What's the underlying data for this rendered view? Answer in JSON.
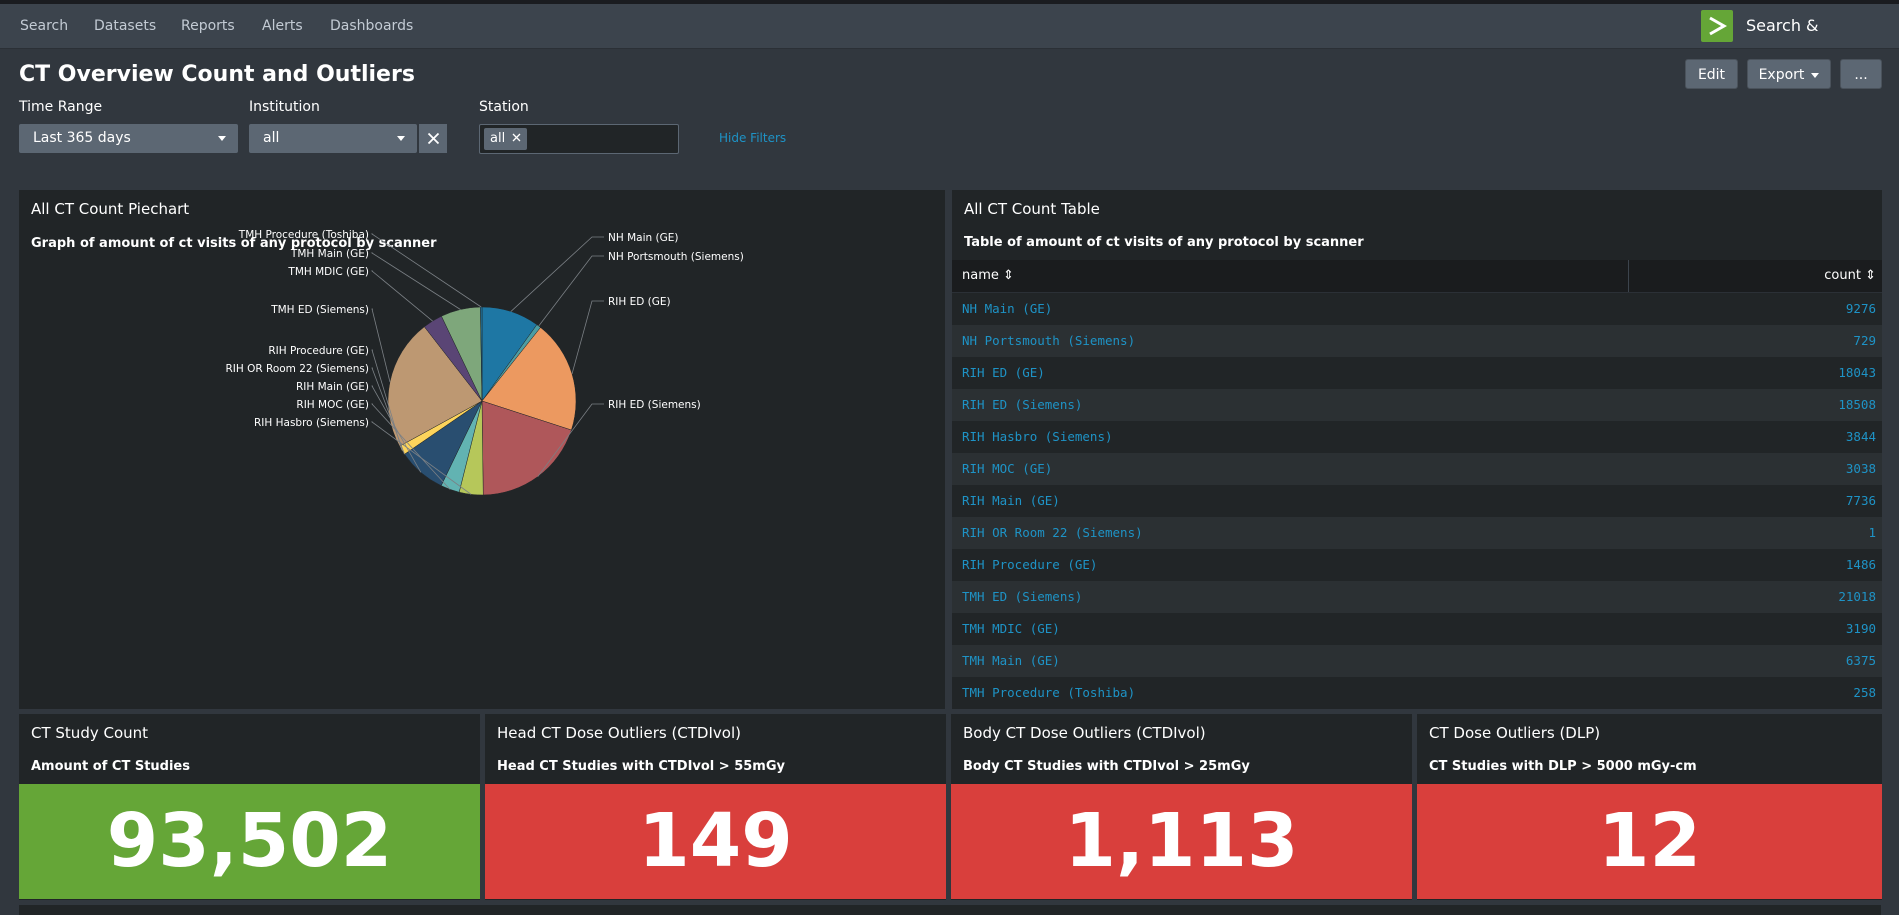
{
  "nav": {
    "items": [
      "Search",
      "Datasets",
      "Reports",
      "Alerts",
      "Dashboards"
    ],
    "app_name": "Search & Reporting",
    "logo_color": "#65a637"
  },
  "dashboard": {
    "title": "CT Overview Count and Outliers",
    "buttons": {
      "edit": "Edit",
      "export": "Export",
      "more": "..."
    }
  },
  "filters": {
    "time_range": {
      "label": "Time Range",
      "value": "Last 365 days"
    },
    "institution": {
      "label": "Institution",
      "value": "all"
    },
    "station": {
      "label": "Station",
      "chips": [
        "all"
      ]
    },
    "hide_label": "Hide Filters"
  },
  "pie_panel": {
    "title": "All CT Count Piechart",
    "subtitle": "Graph of amount of ct visits of any protocol by scanner"
  },
  "chart_data": {
    "type": "pie",
    "title": "Graph of amount of ct visits of any protocol by scanner",
    "slices": [
      {
        "label": "NH Main (GE)",
        "value": 9276,
        "color": "#1e77a4"
      },
      {
        "label": "NH Portsmouth (Siemens)",
        "value": 729,
        "color": "#4d9da3"
      },
      {
        "label": "RIH ED (GE)",
        "value": 18043,
        "color": "#ec9960"
      },
      {
        "label": "RIH ED (Siemens)",
        "value": 18508,
        "color": "#af575a"
      },
      {
        "label": "RIH Hasbro (Siemens)",
        "value": 3844,
        "color": "#b6c75a"
      },
      {
        "label": "RIH MOC (GE)",
        "value": 3038,
        "color": "#62b3b2"
      },
      {
        "label": "RIH Main (GE)",
        "value": 7736,
        "color": "#294e70"
      },
      {
        "label": "RIH OR Room 22 (Siemens)",
        "value": 1,
        "color": "#fcd45c"
      },
      {
        "label": "RIH Procedure (GE)",
        "value": 1486,
        "color": "#fcd45c"
      },
      {
        "label": "TMH ED (Siemens)",
        "value": 21018,
        "color": "#bd9872"
      },
      {
        "label": "TMH MDIC (GE)",
        "value": 3190,
        "color": "#5a4575"
      },
      {
        "label": "TMH Main (GE)",
        "value": 6375,
        "color": "#7ea77b"
      },
      {
        "label": "TMH Procedure (Toshiba)",
        "value": 258,
        "color": "#1e77a4"
      }
    ]
  },
  "table_panel": {
    "title": "All CT Count Table",
    "subtitle": "Table of amount of ct visits of any protocol by scanner",
    "columns": [
      "name",
      "count"
    ],
    "rows": [
      [
        "NH Main (GE)",
        "9276"
      ],
      [
        "NH Portsmouth (Siemens)",
        "729"
      ],
      [
        "RIH ED (GE)",
        "18043"
      ],
      [
        "RIH ED (Siemens)",
        "18508"
      ],
      [
        "RIH Hasbro (Siemens)",
        "3844"
      ],
      [
        "RIH MOC (GE)",
        "3038"
      ],
      [
        "RIH Main (GE)",
        "7736"
      ],
      [
        "RIH OR Room 22 (Siemens)",
        "1"
      ],
      [
        "RIH Procedure (GE)",
        "1486"
      ],
      [
        "TMH ED (Siemens)",
        "21018"
      ],
      [
        "TMH MDIC (GE)",
        "3190"
      ],
      [
        "TMH Main (GE)",
        "6375"
      ],
      [
        "TMH Procedure (Toshiba)",
        "258"
      ]
    ]
  },
  "singles": [
    {
      "title": "CT Study Count",
      "subtitle": "Amount of CT Studies",
      "value": "93,502",
      "color": "#65a637"
    },
    {
      "title": "Head CT Dose Outliers (CTDIvol)",
      "subtitle": "Head CT Studies with CTDIvol > 55mGy",
      "value": "149",
      "color": "#d93f3c"
    },
    {
      "title": "Body CT Dose Outliers (CTDIvol)",
      "subtitle": "Body CT Studies with CTDIvol > 25mGy",
      "value": "1,113",
      "color": "#d93f3c"
    },
    {
      "title": "CT Dose Outliers (DLP)",
      "subtitle": "CT Studies with DLP > 5000 mGy-cm",
      "value": "12",
      "color": "#d93f3c"
    }
  ]
}
